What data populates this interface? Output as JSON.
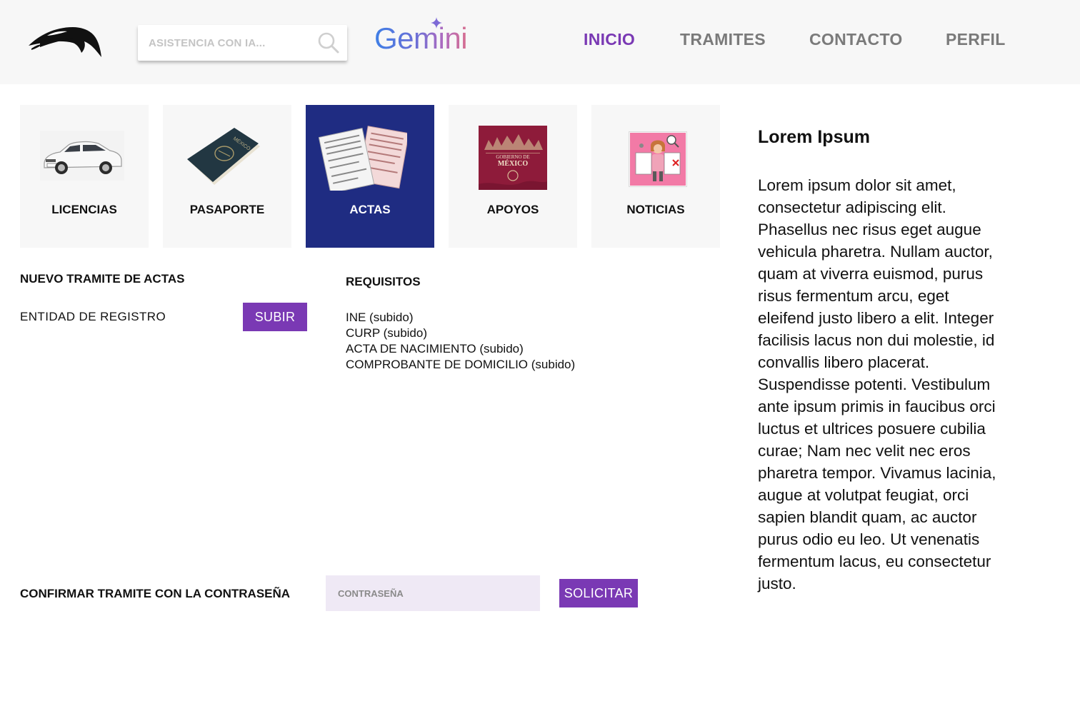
{
  "header": {
    "logo": "dolphin-logo",
    "search": {
      "placeholder": "ASISTENCIA CON IA..."
    },
    "assistant_brand": "Gemini",
    "nav": [
      {
        "label": "INICIO",
        "active": true
      },
      {
        "label": "TRAMITES",
        "active": false
      },
      {
        "label": "CONTACTO",
        "active": false
      },
      {
        "label": "PERFIL",
        "active": false
      }
    ]
  },
  "categories": [
    {
      "label": "LICENCIAS",
      "icon": "car-image",
      "selected": false
    },
    {
      "label": "PASAPORTE",
      "icon": "passport-image",
      "selected": false
    },
    {
      "label": "ACTAS",
      "icon": "certificate-documents-image",
      "selected": true
    },
    {
      "label": "APOYOS",
      "icon": "gobierno-de-mexico-image",
      "image_text": "GOBIERNO DE MÉXICO",
      "selected": false
    },
    {
      "label": "NOTICIAS",
      "icon": "news-illustration-image",
      "selected": false
    }
  ],
  "form": {
    "title": "NUEVO TRAMITE DE ACTAS",
    "entity_label": "ENTIDAD DE REGISTRO",
    "upload_button": "SUBIR"
  },
  "requirements": {
    "title": "REQUISITOS",
    "items": [
      "INE (subido)",
      "CURP (subido)",
      "ACTA DE NACIMIENTO (subido)",
      "COMPROBANTE DE DOMICILIO (subido)"
    ]
  },
  "confirm": {
    "label": "CONFIRMAR TRAMITE CON LA CONTRASEÑA",
    "password_placeholder": "CONTRASEÑA",
    "submit_button": "SOLICITAR"
  },
  "article": {
    "title": "Lorem Ipsum",
    "paragraphs": [
      "Lorem ipsum dolor sit amet, consectetur adipiscing elit. Phasellus nec risus eget augue vehicula pharetra. Nullam auctor, quam at viverra euismod, purus risus fermentum arcu, eget eleifend justo libero a elit. Integer facilisis lacus non dui molestie, id convallis libero placerat.",
      "Suspendisse potenti. Vestibulum ante ipsum primis in faucibus orci luctus et ultrices posuere cubilia curae; Nam nec velit nec eros pharetra tempor. Vivamus lacinia, augue at volutpat feugiat, orci sapien blandit quam, ac auctor purus odio eu leo. Ut venenatis fermentum lacus, eu consectetur justo."
    ]
  },
  "colors": {
    "accent": "#7a39b4",
    "selected_tile": "#1f2c82",
    "header_bg": "#f7f7f7",
    "tile_bg": "#f7f7f7",
    "password_bg": "#efe9f5"
  }
}
